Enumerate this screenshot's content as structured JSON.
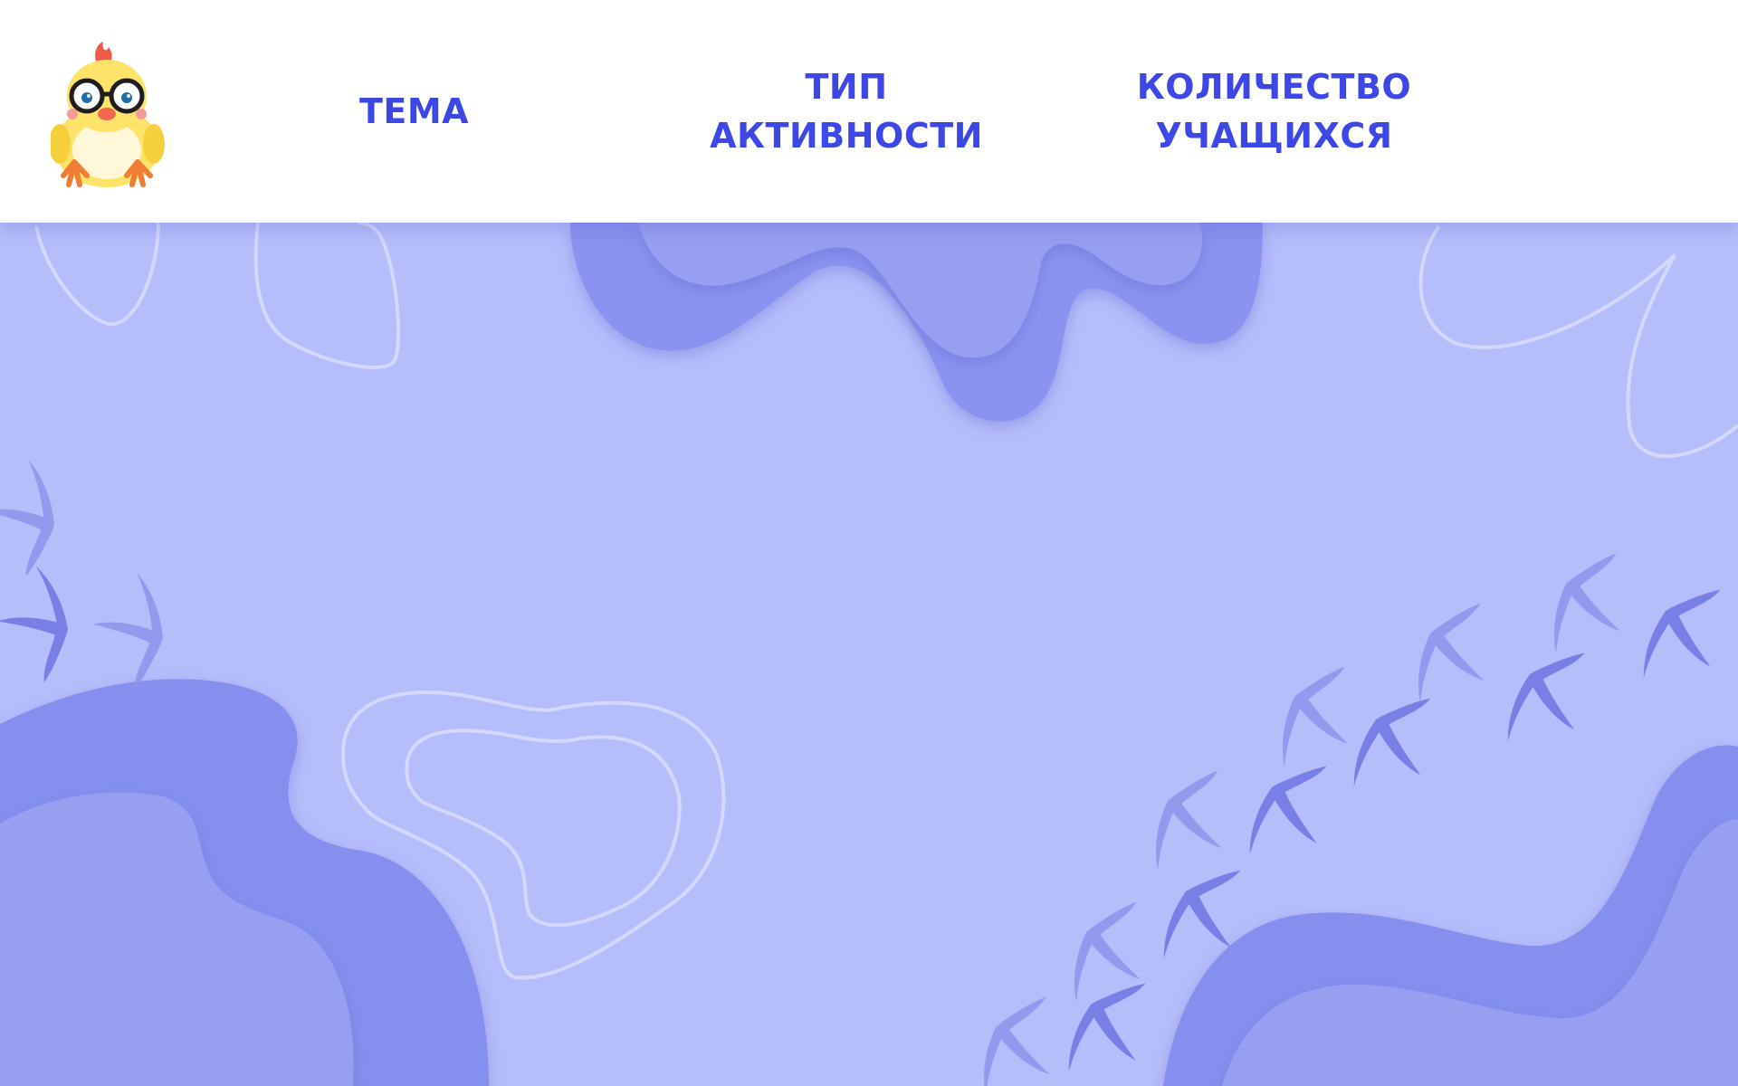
{
  "nav": {
    "theme": {
      "label": "ТЕМА"
    },
    "activity_type": {
      "line1": "ТИП",
      "line2": "АКТИВНОСТИ"
    },
    "students_count": {
      "line1": "КОЛИЧЕСТВО",
      "line2": "УЧАЩИХСЯ"
    }
  },
  "logo": {
    "icon": "chick-mascot-icon"
  },
  "colors": {
    "accent": "#3d47e6",
    "background": "#b6bdfb",
    "blob_dark": "#8590ee",
    "blob_mid": "#969ff0",
    "header": "#ffffff"
  }
}
